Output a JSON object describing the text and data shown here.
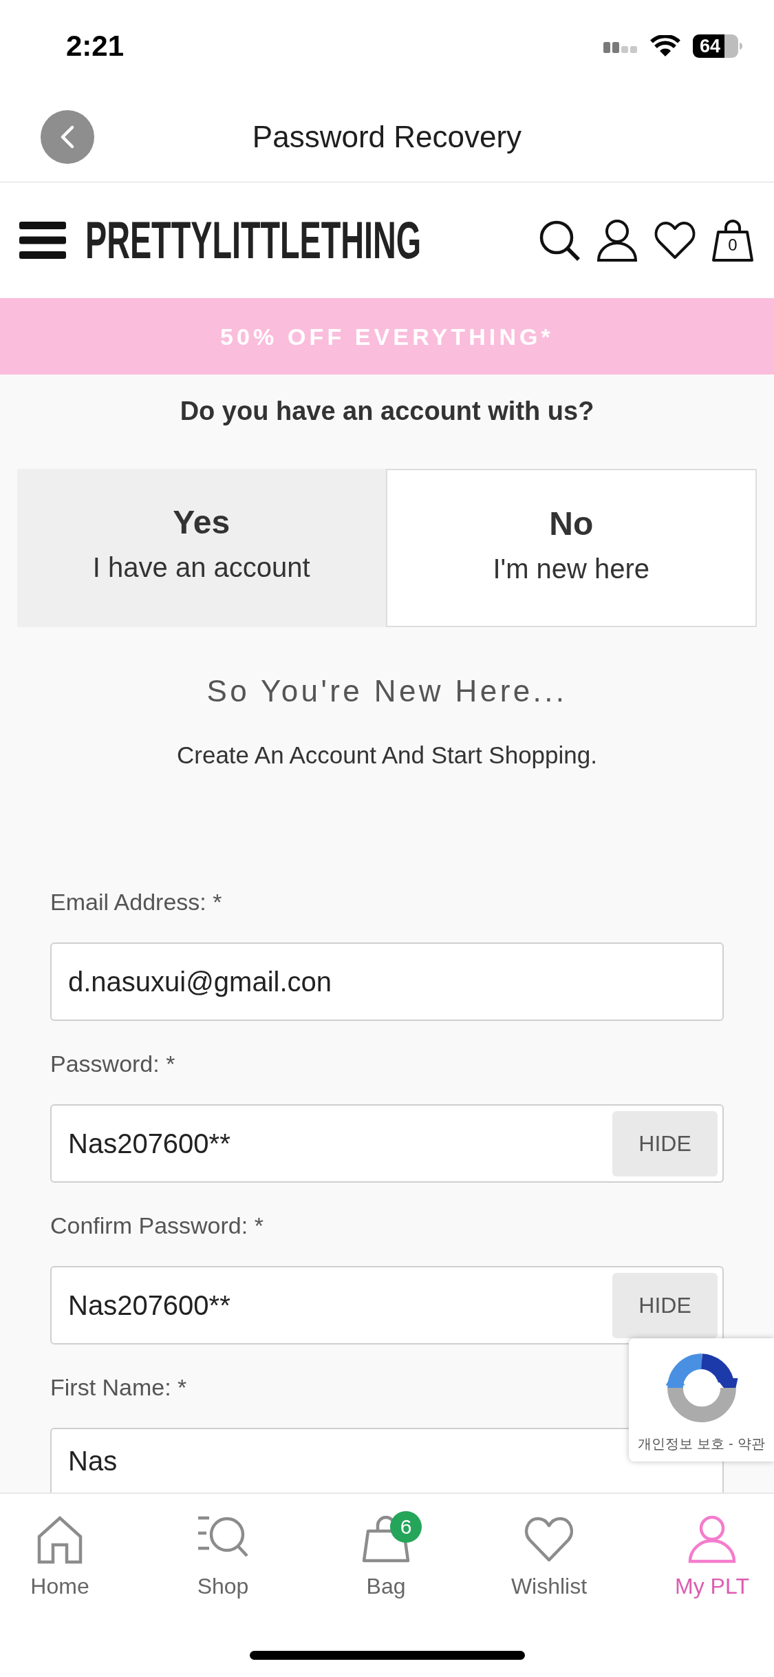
{
  "status_bar": {
    "time": "2:21",
    "battery": "64"
  },
  "nav_bar": {
    "title": "Password Recovery"
  },
  "header": {
    "logo": "PRETTYLITTLETHING",
    "bag_count": "0"
  },
  "promo_banner": {
    "text": "50% OFF EVERYTHING*"
  },
  "account": {
    "question": "Do you have an account with us?",
    "tabs": [
      {
        "title": "Yes",
        "subtitle": "I have an account",
        "selected": false
      },
      {
        "title": "No",
        "subtitle": "I'm new here",
        "selected": true
      }
    ]
  },
  "intro": {
    "heading": "So You're New Here...",
    "subheading": "Create An Account And Start Shopping."
  },
  "form": {
    "fields": [
      {
        "kind": "text",
        "label": "Email Address: *",
        "value": "d.nasuxui@gmail.con"
      },
      {
        "kind": "password",
        "label": "Password: *",
        "value": "Nas207600**",
        "toggle": "HIDE"
      },
      {
        "kind": "password",
        "label": "Confirm Password: *",
        "value": "Nas207600**",
        "toggle": "HIDE"
      },
      {
        "kind": "text",
        "label": "First Name: *",
        "value": "Nas"
      }
    ]
  },
  "captcha": {
    "privacy_link": "개인정보 보호",
    "separator": "-",
    "terms_link": "약관"
  },
  "tab_bar": [
    {
      "label": "Home",
      "selected": false
    },
    {
      "label": "Shop",
      "selected": false
    },
    {
      "label": "Bag",
      "selected": false,
      "badge": "6"
    },
    {
      "label": "Wishlist",
      "selected": false
    },
    {
      "label": "My PLT",
      "selected": true
    }
  ]
}
